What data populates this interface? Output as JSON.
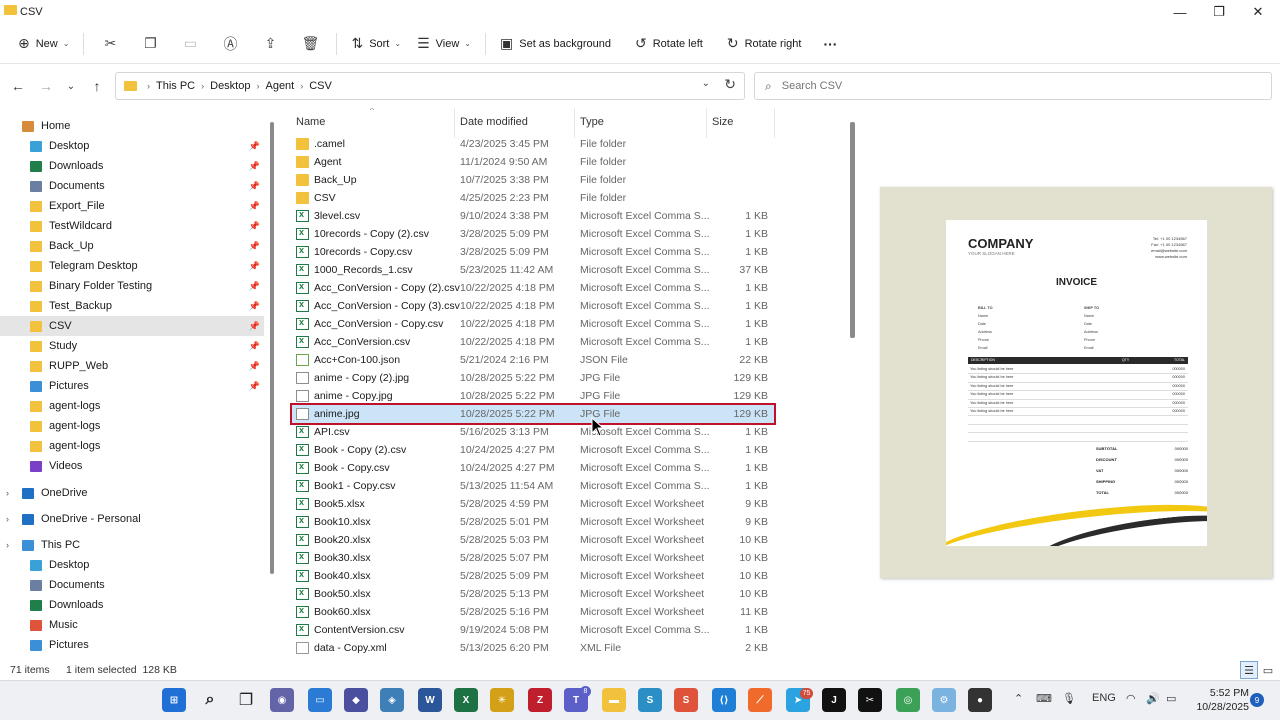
{
  "window": {
    "title": "CSV",
    "minimize": "—",
    "maximize": "❐",
    "close": "✕"
  },
  "toolbar": {
    "new_label": "New",
    "sort_label": "Sort",
    "view_label": "View",
    "set_background_label": "Set as background",
    "rotate_left_label": "Rotate left",
    "rotate_right_label": "Rotate right",
    "more_label": "···"
  },
  "address": {
    "crumbs": [
      "This PC",
      "Desktop",
      "Agent",
      "CSV"
    ],
    "search_placeholder": "Search CSV"
  },
  "sidebar": {
    "home": "Home",
    "quick_access": [
      {
        "label": "Desktop",
        "icon": "desktop-icon",
        "color": "#3aa0d8"
      },
      {
        "label": "Downloads",
        "icon": "download-icon",
        "color": "#1e7f4b"
      },
      {
        "label": "Documents",
        "icon": "document-icon",
        "color": "#6b7fa3"
      },
      {
        "label": "Export_File",
        "icon": "folder-icon",
        "color": "#f3c23c"
      },
      {
        "label": "TestWildcard",
        "icon": "folder-icon",
        "color": "#f3c23c"
      },
      {
        "label": "Back_Up",
        "icon": "folder-icon",
        "color": "#f3c23c"
      },
      {
        "label": "Telegram Desktop",
        "icon": "folder-icon",
        "color": "#f3c23c"
      },
      {
        "label": "Binary Folder Testing",
        "icon": "folder-icon",
        "color": "#f3c23c"
      },
      {
        "label": "Test_Backup",
        "icon": "folder-icon",
        "color": "#f3c23c"
      },
      {
        "label": "CSV",
        "icon": "folder-icon",
        "color": "#f3c23c"
      },
      {
        "label": "Study",
        "icon": "folder-icon",
        "color": "#f3c23c"
      },
      {
        "label": "RUPP_Web",
        "icon": "folder-icon",
        "color": "#f3c23c"
      },
      {
        "label": "Pictures",
        "icon": "pictures-icon",
        "color": "#3a8fd6"
      },
      {
        "label": "agent-logs",
        "icon": "folder-icon",
        "color": "#f3c23c"
      },
      {
        "label": "agent-logs",
        "icon": "folder-icon",
        "color": "#f3c23c"
      },
      {
        "label": "agent-logs",
        "icon": "folder-icon",
        "color": "#f3c23c"
      },
      {
        "label": "Videos",
        "icon": "videos-icon",
        "color": "#7a3fc7"
      }
    ],
    "onedrive": "OneDrive",
    "onedrive_personal": "OneDrive - Personal",
    "this_pc": "This PC",
    "this_pc_items": [
      {
        "label": "Desktop",
        "icon": "desktop-icon",
        "color": "#3aa0d8"
      },
      {
        "label": "Documents",
        "icon": "document-icon",
        "color": "#6b7fa3"
      },
      {
        "label": "Downloads",
        "icon": "download-icon",
        "color": "#1e7f4b"
      },
      {
        "label": "Music",
        "icon": "music-icon",
        "color": "#e0533b"
      },
      {
        "label": "Pictures",
        "icon": "pictures-icon",
        "color": "#3a8fd6"
      }
    ]
  },
  "columns": {
    "name": "Name",
    "date": "Date modified",
    "type": "Type",
    "size": "Size"
  },
  "files": [
    {
      "name": ".camel",
      "date": "4/23/2025 3:45 PM",
      "type": "File folder",
      "size": "",
      "icon": "folder"
    },
    {
      "name": "Agent",
      "date": "11/1/2024 9:50 AM",
      "type": "File folder",
      "size": "",
      "icon": "folder"
    },
    {
      "name": "Back_Up",
      "date": "10/7/2025 3:38 PM",
      "type": "File folder",
      "size": "",
      "icon": "folder"
    },
    {
      "name": "CSV",
      "date": "4/25/2025 2:23 PM",
      "type": "File folder",
      "size": "",
      "icon": "folder"
    },
    {
      "name": "3level.csv",
      "date": "9/10/2024 3:38 PM",
      "type": "Microsoft Excel Comma S...",
      "size": "1 KB",
      "icon": "excel"
    },
    {
      "name": "10records - Copy (2).csv",
      "date": "3/28/2025 5:09 PM",
      "type": "Microsoft Excel Comma S...",
      "size": "1 KB",
      "icon": "excel"
    },
    {
      "name": "10records - Copy.csv",
      "date": "3/28/2025 5:09 PM",
      "type": "Microsoft Excel Comma S...",
      "size": "1 KB",
      "icon": "excel"
    },
    {
      "name": "1000_Records_1.csv",
      "date": "5/23/2025 11:42 AM",
      "type": "Microsoft Excel Comma S...",
      "size": "37 KB",
      "icon": "excel"
    },
    {
      "name": "Acc_ConVersion - Copy (2).csv",
      "date": "10/22/2025 4:18 PM",
      "type": "Microsoft Excel Comma S...",
      "size": "1 KB",
      "icon": "excel"
    },
    {
      "name": "Acc_ConVersion - Copy (3).csv",
      "date": "10/22/2025 4:18 PM",
      "type": "Microsoft Excel Comma S...",
      "size": "1 KB",
      "icon": "excel"
    },
    {
      "name": "Acc_ConVersion - Copy.csv",
      "date": "10/22/2025 4:18 PM",
      "type": "Microsoft Excel Comma S...",
      "size": "1 KB",
      "icon": "excel"
    },
    {
      "name": "Acc_ConVersion.csv",
      "date": "10/22/2025 4:18 PM",
      "type": "Microsoft Excel Comma S...",
      "size": "1 KB",
      "icon": "excel"
    },
    {
      "name": "Acc+Con-100.json",
      "date": "5/21/2024 2:16 PM",
      "type": "JSON File",
      "size": "22 KB",
      "icon": "json"
    },
    {
      "name": "anime - Copy (2).jpg",
      "date": "10/28/2025 5:22 PM",
      "type": "JPG File",
      "size": "129 KB",
      "icon": "jpg"
    },
    {
      "name": "anime - Copy.jpg",
      "date": "10/28/2025 5:22 PM",
      "type": "JPG File",
      "size": "129 KB",
      "icon": "jpg"
    },
    {
      "name": "anime.jpg",
      "date": "10/28/2025 5:22 PM",
      "type": "JPG File",
      "size": "129 KB",
      "icon": "jpg",
      "selected": true
    },
    {
      "name": "API.csv",
      "date": "5/16/2025 3:13 PM",
      "type": "Microsoft Excel Comma S...",
      "size": "1 KB",
      "icon": "excel"
    },
    {
      "name": "Book - Copy (2).csv",
      "date": "10/24/2025 4:27 PM",
      "type": "Microsoft Excel Comma S...",
      "size": "1 KB",
      "icon": "excel"
    },
    {
      "name": "Book - Copy.csv",
      "date": "10/24/2025 4:27 PM",
      "type": "Microsoft Excel Comma S...",
      "size": "1 KB",
      "icon": "excel"
    },
    {
      "name": "Book1 - Copy.csv",
      "date": "5/13/2025 11:54 AM",
      "type": "Microsoft Excel Comma S...",
      "size": "1 KB",
      "icon": "excel"
    },
    {
      "name": "Book5.xlsx",
      "date": "5/28/2025 4:59 PM",
      "type": "Microsoft Excel Worksheet",
      "size": "9 KB",
      "icon": "excel"
    },
    {
      "name": "Book10.xlsx",
      "date": "5/28/2025 5:01 PM",
      "type": "Microsoft Excel Worksheet",
      "size": "9 KB",
      "icon": "excel"
    },
    {
      "name": "Book20.xlsx",
      "date": "5/28/2025 5:03 PM",
      "type": "Microsoft Excel Worksheet",
      "size": "10 KB",
      "icon": "excel"
    },
    {
      "name": "Book30.xlsx",
      "date": "5/28/2025 5:07 PM",
      "type": "Microsoft Excel Worksheet",
      "size": "10 KB",
      "icon": "excel"
    },
    {
      "name": "Book40.xlsx",
      "date": "5/28/2025 5:09 PM",
      "type": "Microsoft Excel Worksheet",
      "size": "10 KB",
      "icon": "excel"
    },
    {
      "name": "Book50.xlsx",
      "date": "5/28/2025 5:13 PM",
      "type": "Microsoft Excel Worksheet",
      "size": "10 KB",
      "icon": "excel"
    },
    {
      "name": "Book60.xlsx",
      "date": "5/28/2025 5:16 PM",
      "type": "Microsoft Excel Worksheet",
      "size": "11 KB",
      "icon": "excel"
    },
    {
      "name": "ContentVersion.csv",
      "date": "9/19/2024 5:08 PM",
      "type": "Microsoft Excel Comma S...",
      "size": "1 KB",
      "icon": "excel"
    },
    {
      "name": "data - Copy.xml",
      "date": "5/13/2025 6:20 PM",
      "type": "XML File",
      "size": "2 KB",
      "icon": "xml"
    }
  ],
  "preview": {
    "company": "COMPANY",
    "slogan": "YOUR SLOGAN HERE",
    "contact": [
      "Tel: +1 00 1234567",
      "Fax: +1 00 1234567",
      "email@website.com",
      "www.website.com"
    ],
    "invoice_title": "INVOICE",
    "bill_to": "BILL TO",
    "ship_to": "SHIP TO",
    "fields": [
      "Name",
      "Date",
      "Address",
      "Phone",
      "Email"
    ],
    "table_desc": "DESCRIPTION",
    "table_qty": "QTY",
    "table_total": "TOTAL",
    "line_text": "You listing should be here",
    "line_amount": "000000",
    "totals": [
      {
        "label": "SUBTOTAL",
        "value": "000000"
      },
      {
        "label": "DISCOUNT",
        "value": "000000"
      },
      {
        "label": "VAT",
        "value": "000000"
      },
      {
        "label": "SHIPPING",
        "value": "000000"
      },
      {
        "label": "TOTAL",
        "value": "000000"
      }
    ]
  },
  "status": {
    "count": "71 items",
    "selection": "1 item selected  128 KB"
  },
  "taskbar": {
    "teams_badge": "8",
    "other_badge": "75",
    "language": "ENG",
    "time": "5:52 PM",
    "date": "10/28/2025",
    "notifications": "9"
  }
}
